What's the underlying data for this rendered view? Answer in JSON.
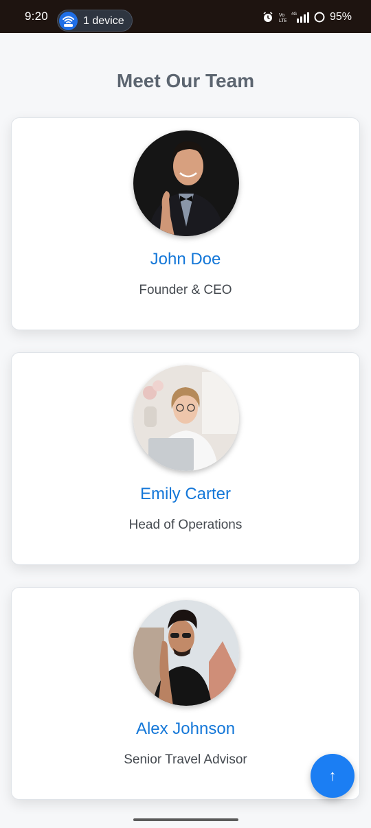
{
  "status_bar": {
    "time": "9:20",
    "hotspot_label": "1 device",
    "hotspot_icon": "wifi-hotspot-icon",
    "alarm_icon": "alarm-icon",
    "volte_icon": "volte-icon",
    "network_label": "4G",
    "signal_icon": "signal-icon",
    "battery_icon": "battery-ring-icon",
    "battery": "95%"
  },
  "page": {
    "title": "Meet Our Team"
  },
  "team": [
    {
      "name": "John Doe",
      "role": "Founder & CEO"
    },
    {
      "name": "Emily Carter",
      "role": "Head of Operations"
    },
    {
      "name": "Alex Johnson",
      "role": "Senior Travel Advisor"
    }
  ],
  "fab": {
    "label": "↑",
    "icon": "arrow-up-icon"
  },
  "colors": {
    "accent": "#1477d8",
    "fab": "#1b7ef3",
    "title": "#5c6570",
    "status_bar": "#1e1410"
  }
}
